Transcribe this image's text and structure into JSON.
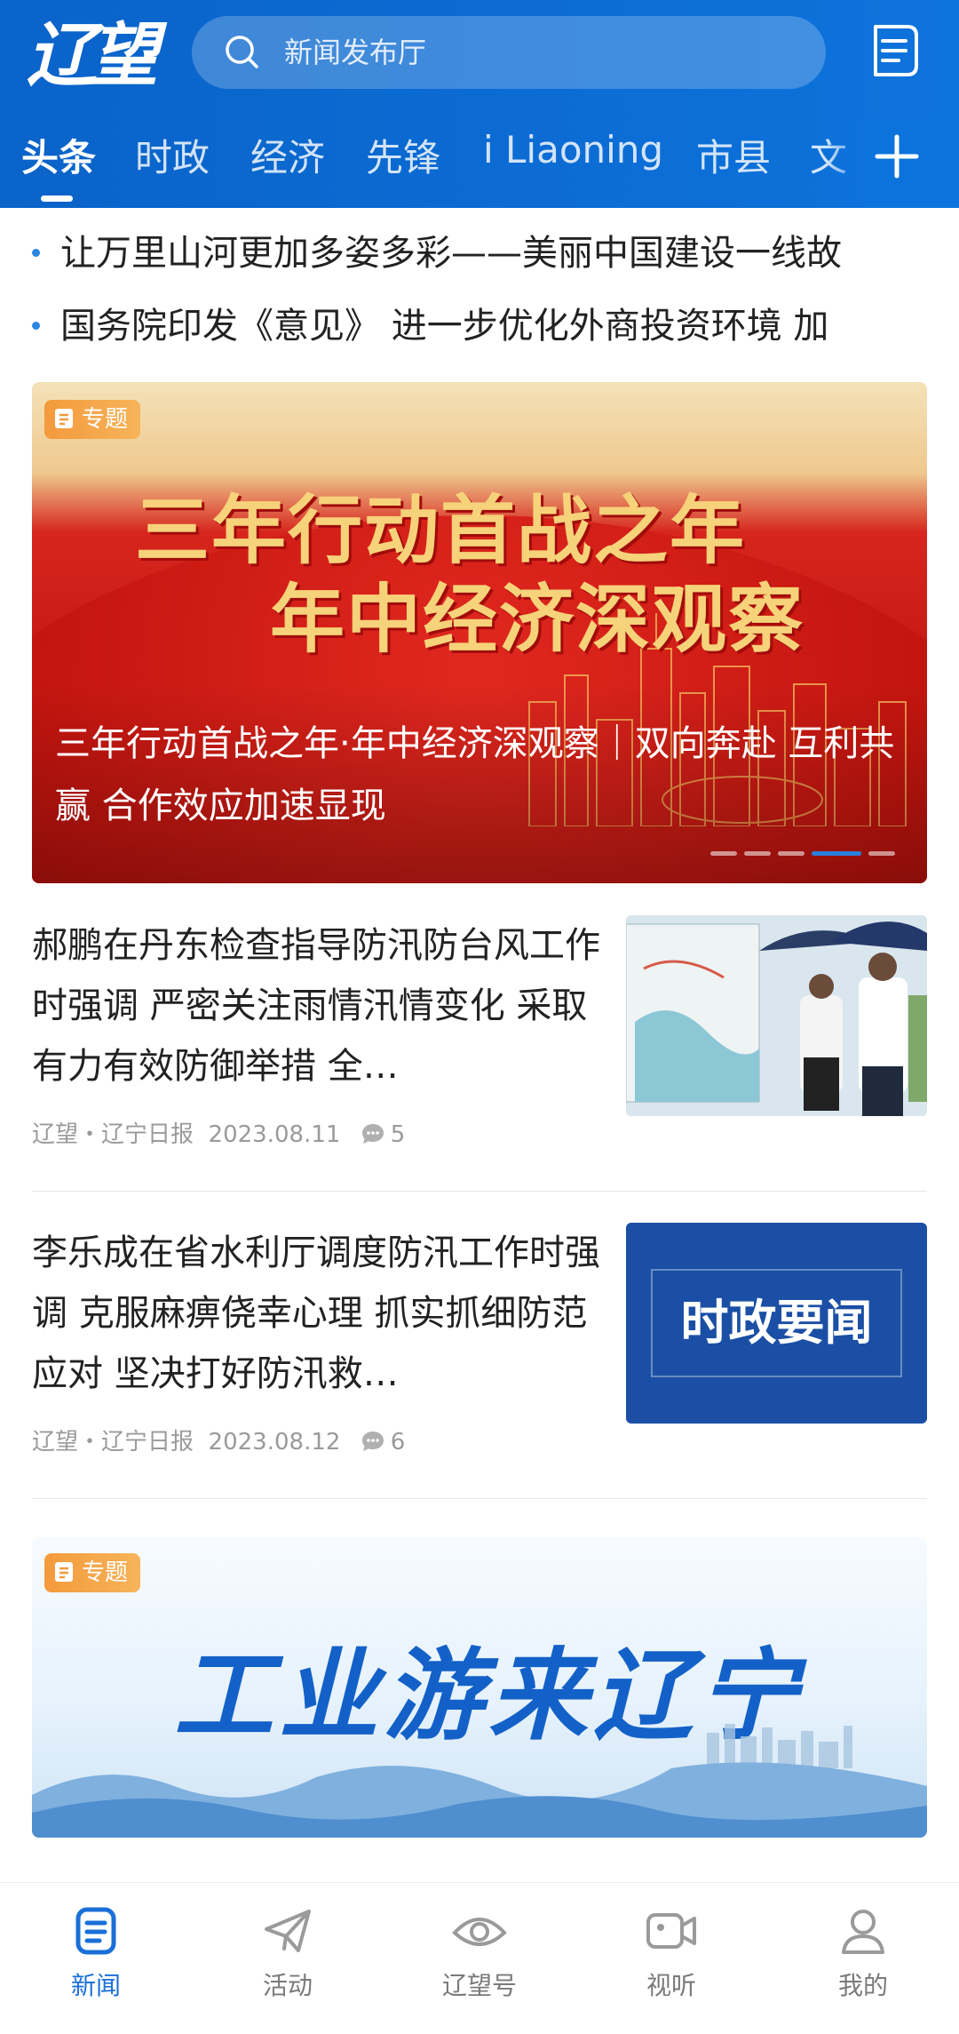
{
  "header": {
    "logo_text": "辽望",
    "search_placeholder": "新闻发布厅",
    "tabs": [
      "头条",
      "时政",
      "经济",
      "先锋",
      "i Liaoning",
      "市县",
      "文"
    ],
    "active_tab": "头条"
  },
  "ticker": [
    "让万里山河更加多姿多彩——美丽中国建设一线故",
    "国务院印发《意见》 进一步优化外商投资环境 加"
  ],
  "banner1": {
    "tag": "专题",
    "headline_line1": "三年行动首战之年",
    "headline_line2": "年中经济深观察",
    "caption": "三年行动首战之年·年中经济深观察｜双向奔赴 互利共赢 合作效应加速显现",
    "slide_count": 5,
    "active_slide": 4
  },
  "articles": [
    {
      "title": "郝鹏在丹东检查指导防汛防台风工作时强调 严密关注雨情汛情变化 采取有力有效防御举措 全…",
      "source": "辽望・辽宁日报",
      "date": "2023.08.11",
      "comments": "5"
    },
    {
      "title": "李乐成在省水利厅调度防汛工作时强调 克服麻痹侥幸心理 抓实抓细防范应对 坚决打好防汛救…",
      "source": "辽望・辽宁日报",
      "date": "2023.08.12",
      "comments": "6",
      "thumb_text": "时政要闻"
    }
  ],
  "banner2": {
    "tag": "专题",
    "title": "工业游来辽宁"
  },
  "bottom_nav": [
    {
      "label": "新闻",
      "icon": "news-icon",
      "active": true
    },
    {
      "label": "活动",
      "icon": "paper-plane-icon",
      "active": false
    },
    {
      "label": "辽望号",
      "icon": "eye-icon",
      "active": false
    },
    {
      "label": "视听",
      "icon": "video-icon",
      "active": false
    },
    {
      "label": "我的",
      "icon": "profile-icon",
      "active": false
    }
  ],
  "colors": {
    "brand_blue": "#0d73dc",
    "active_nav": "#1a6fd8",
    "tag_orange": "#f39a3c",
    "banner_red": "#c21812"
  }
}
